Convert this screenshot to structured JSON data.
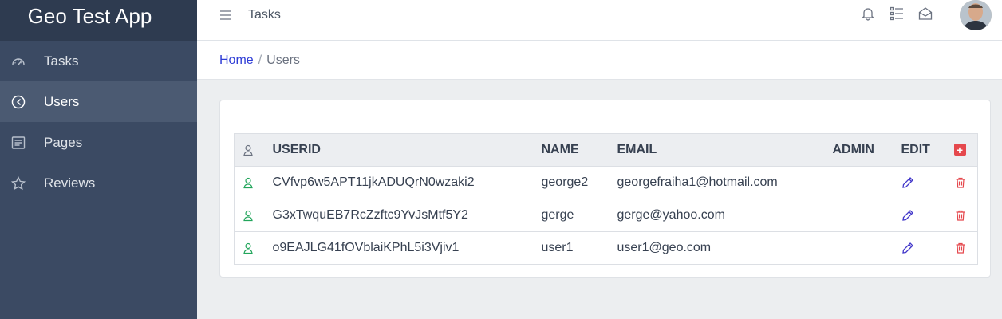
{
  "app": {
    "title": "Geo Test App"
  },
  "sidebar": {
    "items": [
      {
        "label": "Tasks",
        "icon": "speedometer-icon",
        "active": false
      },
      {
        "label": "Users",
        "icon": "compass-icon",
        "active": true
      },
      {
        "label": "Pages",
        "icon": "document-icon",
        "active": false
      },
      {
        "label": "Reviews",
        "icon": "star-icon",
        "active": false
      }
    ]
  },
  "topbar": {
    "title": "Tasks",
    "icons": [
      "bell-icon",
      "list-icon",
      "envelope-open-icon"
    ],
    "avatar": "user-avatar"
  },
  "breadcrumb": {
    "home": "Home",
    "current": "Users"
  },
  "users_table": {
    "columns": {
      "userid": "USERID",
      "name": "NAME",
      "email": "EMAIL",
      "admin": "ADMIN",
      "edit": "EDIT"
    },
    "rows": [
      {
        "userid": "CVfvp6w5APT11jkADUQrN0wzaki2",
        "name": "george2",
        "email": "georgefraiha1@hotmail.com",
        "admin": ""
      },
      {
        "userid": "G3xTwquEB7RcZzftc9YvJsMtf5Y2",
        "name": "gerge",
        "email": "gerge@yahoo.com",
        "admin": ""
      },
      {
        "userid": "o9EAJLG41fOVblaiKPhL5i3Vjiv1",
        "name": "user1",
        "email": "user1@geo.com",
        "admin": ""
      }
    ]
  },
  "colors": {
    "sidebar_bg": "#3b4a63",
    "brand_bg": "#2e3b50",
    "active_item": "#4b5a72",
    "user_icon": "#22a55b",
    "edit_icon": "#4338ca",
    "delete_icon": "#e5484d",
    "add_button": "#e5484d",
    "link": "#2f3dd6"
  }
}
